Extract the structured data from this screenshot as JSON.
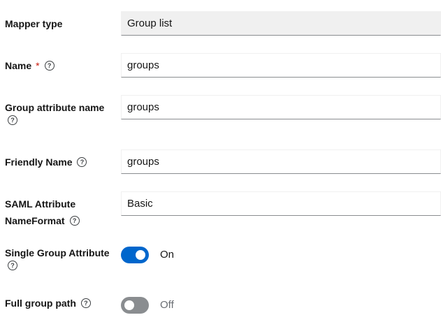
{
  "mapper_type": {
    "label": "Mapper type",
    "value": "Group list"
  },
  "name": {
    "label": "Name",
    "required_mark": "*",
    "value": "groups"
  },
  "group_attribute_name": {
    "label": "Group attribute name",
    "value": "groups"
  },
  "friendly_name": {
    "label": "Friendly Name",
    "value": "groups"
  },
  "saml_nameformat": {
    "label_line1": "SAML Attribute",
    "label_line2": "NameFormat",
    "value": "Basic"
  },
  "single_group_attribute": {
    "label": "Single Group Attribute",
    "state": "On",
    "enabled": true
  },
  "full_group_path": {
    "label": "Full group path",
    "state": "Off",
    "enabled": false
  },
  "help_glyph": "?",
  "colors": {
    "toggle_on": "#0066cc",
    "toggle_off": "#8a8d90",
    "required": "#c9190b"
  }
}
